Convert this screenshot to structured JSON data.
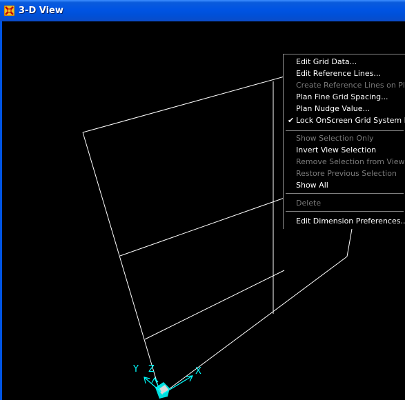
{
  "window": {
    "title": "3-D View",
    "app_icon": "sap-app-icon"
  },
  "axes": {
    "x_label": "X",
    "y_label": "Y",
    "z_label": "Z"
  },
  "colors": {
    "titlebar": "#0054e3",
    "grid_lines": "#ffffff",
    "axis_triad": "#00ffff",
    "background": "#000000"
  },
  "context_menu": {
    "items": [
      {
        "label": "Edit Grid Data...",
        "enabled": true
      },
      {
        "label": "Edit Reference Lines...",
        "enabled": true
      },
      {
        "label": "Create Reference Lines on Plan",
        "enabled": false
      },
      {
        "label": "Plan Fine Grid Spacing...",
        "enabled": true
      },
      {
        "label": "Plan Nudge Value...",
        "enabled": true
      },
      {
        "label": "Lock OnScreen Grid System Edit",
        "enabled": true,
        "checked": true
      },
      {
        "label": "Show Selection Only",
        "enabled": false
      },
      {
        "label": "Invert View Selection",
        "enabled": true
      },
      {
        "label": "Remove Selection from View",
        "enabled": false
      },
      {
        "label": "Restore Previous Selection",
        "enabled": false
      },
      {
        "label": "Show All",
        "enabled": true
      },
      {
        "label": "Delete",
        "enabled": false
      },
      {
        "label": "Edit Dimension Preferences...",
        "enabled": true
      }
    ]
  }
}
